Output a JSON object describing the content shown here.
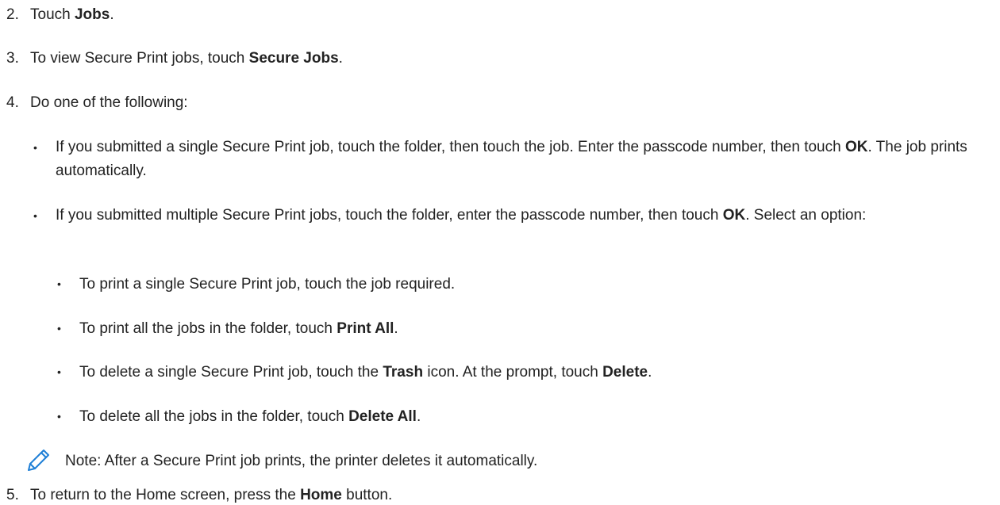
{
  "steps": [
    {
      "num": "2.",
      "pre": "Touch ",
      "b1": "Jobs",
      "post": "."
    },
    {
      "num": "3.",
      "pre": "To view Secure Print jobs, touch ",
      "b1": "Secure Jobs",
      "post": "."
    },
    {
      "num": "4.",
      "text": "Do one of the following:"
    },
    {
      "num": "5.",
      "pre": "To return to the Home screen, press the ",
      "b1": "Home",
      "post": " button."
    }
  ],
  "options": [
    {
      "pre": "If you submitted a single Secure Print job, touch the folder, then touch the job. Enter the passcode number, then touch ",
      "b1": "OK",
      "post": ". The job prints automatically."
    },
    {
      "pre": "If you submitted multiple Secure Print jobs, touch the folder, enter the passcode number, then touch ",
      "b1": "OK",
      "post": ". Select an option:"
    }
  ],
  "sub_options": [
    {
      "pre": "To print a single Secure Print job, touch the job required."
    },
    {
      "pre": "To print all the jobs in the folder, touch ",
      "b1": "Print All",
      "post": "."
    },
    {
      "pre": "To delete a single Secure Print job, touch the ",
      "b1": "Trash",
      "mid": " icon. At the prompt, touch ",
      "b2": "Delete",
      "post": "."
    },
    {
      "pre": "To delete all the jobs in the folder, touch ",
      "b1": "Delete All",
      "post": "."
    }
  ],
  "note": {
    "icon": "pencil-icon",
    "icon_color": "#1f7fd6",
    "text": "Note: After a Secure Print job prints, the printer deletes it automatically."
  },
  "bullet_char": "•"
}
